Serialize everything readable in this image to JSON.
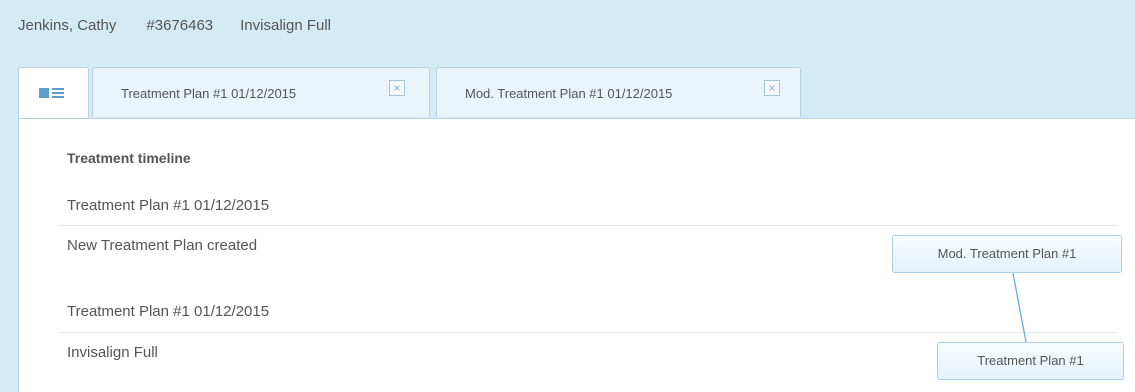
{
  "patient": {
    "name": "Jenkins, Cathy",
    "id": "#3676463",
    "plan_type": "Invisalign Full"
  },
  "tabs": [
    {
      "label": "",
      "icon": "list-view-icon",
      "active": true
    },
    {
      "label": "Treatment Plan #1 01/12/2015",
      "closable": true,
      "close_glyph": "×"
    },
    {
      "label": "Mod. Treatment Plan #1 01/12/2015",
      "closable": true,
      "close_glyph": "×"
    }
  ],
  "timeline": {
    "title": "Treatment timeline",
    "entries": [
      {
        "heading": "Treatment Plan #1 01/12/2015",
        "description": "New Treatment Plan created"
      },
      {
        "heading": "Treatment Plan #1 01/12/2015",
        "description": "Invisalign Full"
      }
    ]
  },
  "graph": {
    "nodes": [
      {
        "label": "Mod. Treatment Plan #1"
      },
      {
        "label": "Treatment Plan #1"
      }
    ]
  },
  "colors": {
    "header_bg": "#d4ebf6",
    "accent": "#5a9fcb",
    "border": "#b5d3e4",
    "text": "#555555"
  }
}
